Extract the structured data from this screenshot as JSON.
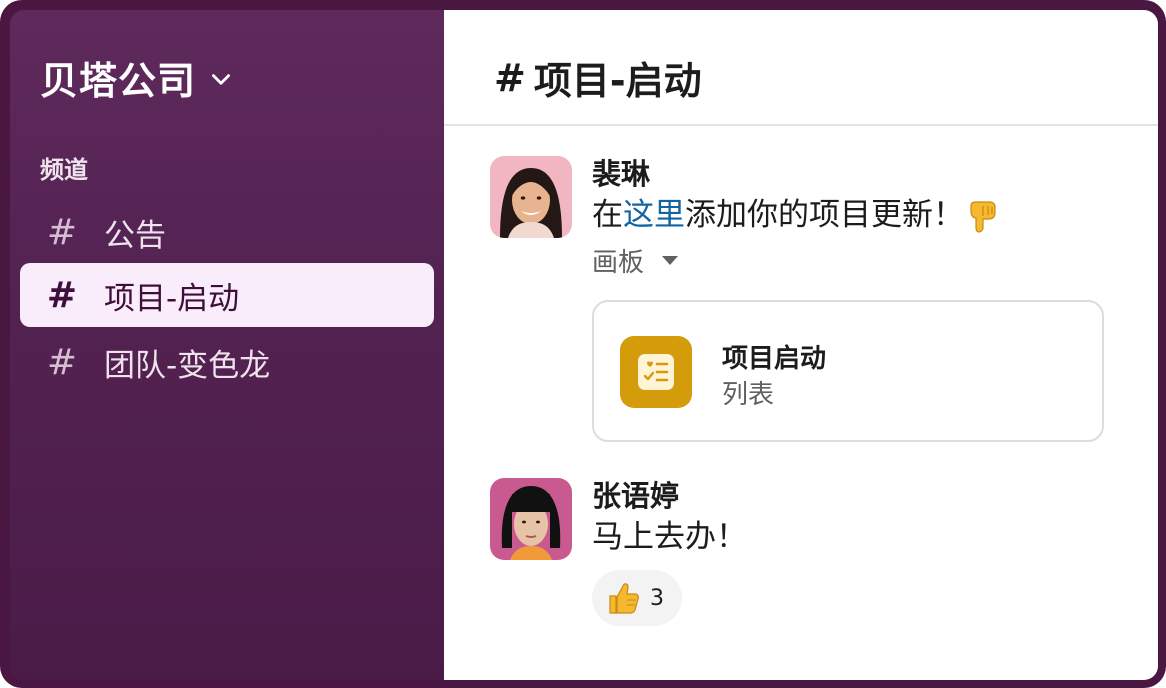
{
  "workspace": {
    "name": "贝塔公司"
  },
  "sidebar": {
    "section_label": "频道",
    "channels": [
      {
        "hash": "#",
        "label": "公告",
        "active": false
      },
      {
        "hash": "#",
        "label": "项目-启动",
        "active": true
      },
      {
        "hash": "#",
        "label": "团队-变色龙",
        "active": false
      }
    ]
  },
  "header": {
    "hash": "#",
    "title": "项目-启动"
  },
  "messages": [
    {
      "author": "裴琳",
      "text_before": "在",
      "link": "这里",
      "text_after": "添加你的项目更新！",
      "canvas_toggle": "画板",
      "card": {
        "title": "项目启动",
        "subtitle": "列表"
      }
    },
    {
      "author": "张语婷",
      "text": "马上去办！",
      "reaction": {
        "emoji": "thumbs-up",
        "count": "3"
      }
    }
  ],
  "colors": {
    "sidebar": "#532251",
    "active_channel": "#f9ecfb",
    "link": "#1264a3",
    "card_icon": "#d49b0a"
  }
}
